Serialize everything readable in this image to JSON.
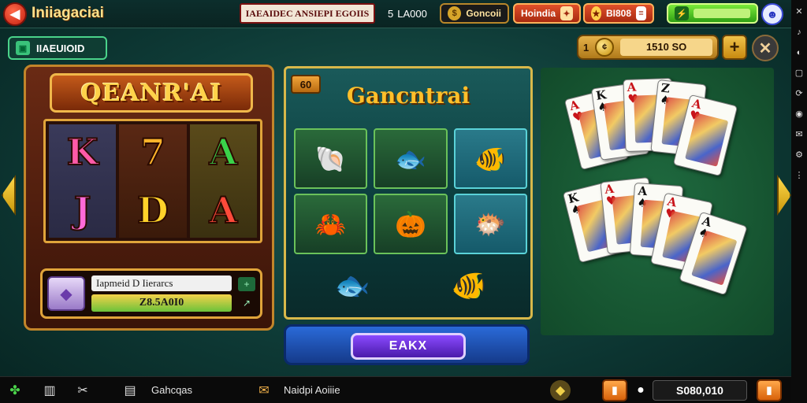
{
  "topbar": {
    "title": "Iniiagaciai",
    "promo": "IAEAIDEC ANSIEPI EGOIIS",
    "chip1": "LA000",
    "chip1_prefix": "5",
    "gold_label": "Goncoii",
    "red_label": "Hoindia",
    "red2_label": "BI808",
    "green_value": ""
  },
  "subbar": {
    "tag_label": "IIAEUIOID",
    "coin_prefix": "1",
    "coin_value": "1510 SO"
  },
  "slot": {
    "title": "QEANR'AI",
    "symbols": [
      {
        "glyph": "K",
        "color": "#ff5aa8"
      },
      {
        "glyph": "J",
        "color": "#ff6ad8"
      },
      {
        "glyph": "7",
        "color": "#ffb42a"
      },
      {
        "glyph": "D",
        "color": "#ffd22a"
      },
      {
        "glyph": "A",
        "color": "#3ad24a"
      },
      {
        "glyph": "A",
        "color": "#ff4a3a"
      }
    ],
    "info_label": "Iapmeid D Iierarcs",
    "info_value": "Z8.5A0I0"
  },
  "fish": {
    "badge": "60",
    "title": "Gancntrai",
    "cells": [
      "🐚",
      "🐟",
      "🐠",
      "🦀",
      "🎃",
      "🐡"
    ],
    "bottom": [
      "🐟",
      "🐠"
    ],
    "spin_label": "EAKX"
  },
  "cards": {
    "top_row": [
      {
        "rank": "A",
        "suit": "♥",
        "color": "red"
      },
      {
        "rank": "K",
        "suit": "♠",
        "color": "blk"
      },
      {
        "rank": "A",
        "suit": "♥",
        "color": "red"
      },
      {
        "rank": "Z",
        "suit": "♠",
        "color": "blk"
      },
      {
        "rank": "A",
        "suit": "♥",
        "color": "red"
      }
    ],
    "bottom_row": [
      {
        "rank": "K",
        "suit": "♠",
        "color": "blk"
      },
      {
        "rank": "A",
        "suit": "♥",
        "color": "red"
      },
      {
        "rank": "A",
        "suit": "♠",
        "color": "blk"
      },
      {
        "rank": "A",
        "suit": "♥",
        "color": "red"
      },
      {
        "rank": "A",
        "suit": "♠",
        "color": "blk"
      }
    ]
  },
  "bottombar": {
    "label1": "Gahcqas",
    "label2": "Naidpi Aoiiie",
    "money": "S080,010"
  }
}
